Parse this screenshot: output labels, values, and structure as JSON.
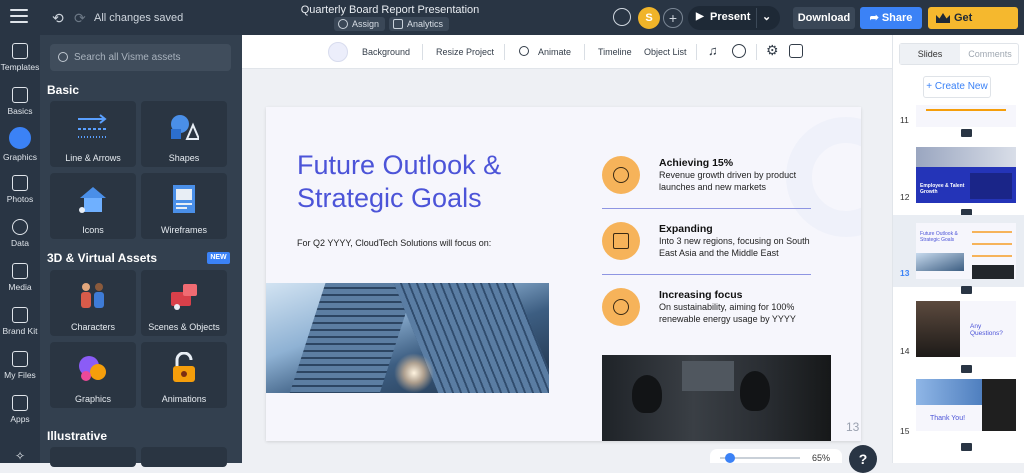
{
  "topbar": {
    "saved_status": "All changes saved",
    "title": "Quarterly Board Report Presentation",
    "assign_label": "Assign",
    "analytics_label": "Analytics",
    "avatar_initial": "S",
    "present_label": "Present",
    "download_label": "Download",
    "share_label": "Share",
    "premium_label": "Get Premium"
  },
  "iconbar": {
    "items": [
      {
        "label": "Templates"
      },
      {
        "label": "Basics"
      },
      {
        "label": "Graphics"
      },
      {
        "label": "Photos"
      },
      {
        "label": "Data"
      },
      {
        "label": "Media"
      },
      {
        "label": "Brand Kit"
      },
      {
        "label": "My Files"
      },
      {
        "label": "Apps"
      }
    ]
  },
  "panel": {
    "search_placeholder": "Search all Visme assets",
    "section_basic": "Basic",
    "section_3d": "3D & Virtual Assets",
    "new_badge": "NEW",
    "section_illustrative": "Illustrative",
    "cards": [
      {
        "label": "Line & Arrows"
      },
      {
        "label": "Shapes"
      },
      {
        "label": "Icons"
      },
      {
        "label": "Wireframes"
      },
      {
        "label": "Characters"
      },
      {
        "label": "Scenes & Objects"
      },
      {
        "label": "Graphics"
      },
      {
        "label": "Animations"
      }
    ]
  },
  "subbar": {
    "background": "Background",
    "resize": "Resize Project",
    "animate": "Animate",
    "timeline": "Timeline",
    "object_list": "Object List"
  },
  "slide": {
    "title": "Future Outlook & Strategic Goals",
    "subtitle": "For Q2 YYYY, CloudTech Solutions will focus on:",
    "goals": [
      {
        "heading": "Achieving 15%",
        "text": "Revenue growth driven by product launches and new markets"
      },
      {
        "heading": "Expanding",
        "text": "Into 3 new regions, focusing on South East Asia and the Middle East"
      },
      {
        "heading": "Increasing focus",
        "text": "On sustainability, aiming for 100% renewable energy usage by YYYY"
      }
    ],
    "page_number": "13"
  },
  "zoom": {
    "value": "65%",
    "level_percent": 65
  },
  "help": "?",
  "right": {
    "tab_slides": "Slides",
    "tab_comments": "Comments",
    "create_new": "+ Create New",
    "slide_numbers": [
      "11",
      "12",
      "13",
      "14",
      "15"
    ],
    "thumb12_text": "Employee & Talent Growth",
    "thumb13_text": "Future Outlook & Strategic Goals",
    "thumb14_text": "Any Questions?",
    "thumb15_text": "Thank You!"
  },
  "colors": {
    "accent": "#3b82f6",
    "title_purple": "#4c54d8",
    "premium": "#f5b82e",
    "goal_icon": "#f6b35a"
  }
}
